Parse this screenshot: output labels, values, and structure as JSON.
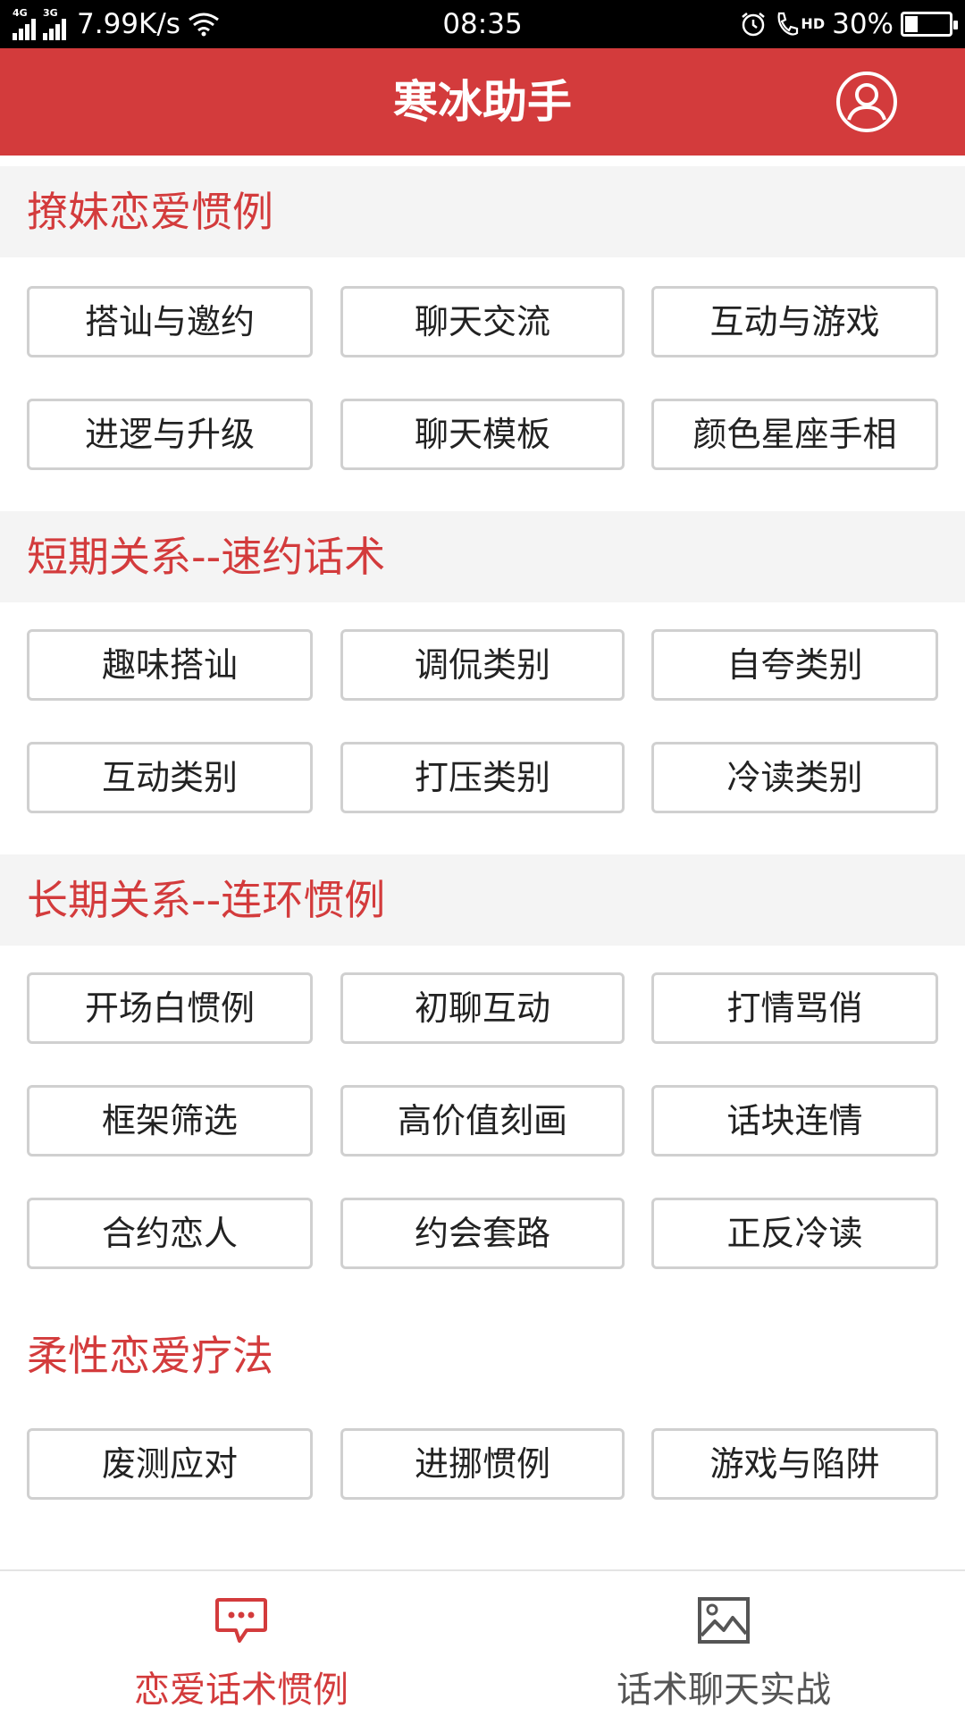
{
  "status_bar": {
    "network_1": "4G",
    "network_2": "3G",
    "speed": "7.99K/s",
    "time": "08:35",
    "hd": "HD",
    "battery": "30%",
    "battery_level": 0.3
  },
  "header": {
    "title": "寒冰助手",
    "user_icon": "user-icon"
  },
  "sections": [
    {
      "title": "撩妹恋爱惯例",
      "items": [
        "搭讪与邀约",
        "聊天交流",
        "互动与游戏",
        "进逻与升级",
        "聊天模板",
        "颜色星座手相"
      ]
    },
    {
      "title": "短期关系--速约话术",
      "items": [
        "趣味搭讪",
        "调侃类别",
        "自夸类别",
        "互动类别",
        "打压类别",
        "冷读类别"
      ]
    },
    {
      "title": "长期关系--连环惯例",
      "items": [
        "开场白惯例",
        "初聊互动",
        "打情骂俏",
        "框架筛选",
        "高价值刻画",
        "话块连情",
        "合约恋人",
        "约会套路",
        "正反冷读"
      ]
    },
    {
      "title": "柔性恋爱疗法",
      "items": [
        "废测应对",
        "进挪惯例",
        "游戏与陷阱"
      ]
    }
  ],
  "tab_bar": {
    "tabs": [
      {
        "label": "恋爱话术惯例",
        "icon": "chat-bubble-icon",
        "active": true
      },
      {
        "label": "话术聊天实战",
        "icon": "image-icon",
        "active": false
      }
    ],
    "active_color": "#d33b3c"
  },
  "colors": {
    "brand": "#d33b3c",
    "section_bg": "#f4f4f4",
    "button_border": "#d0d0d0"
  }
}
